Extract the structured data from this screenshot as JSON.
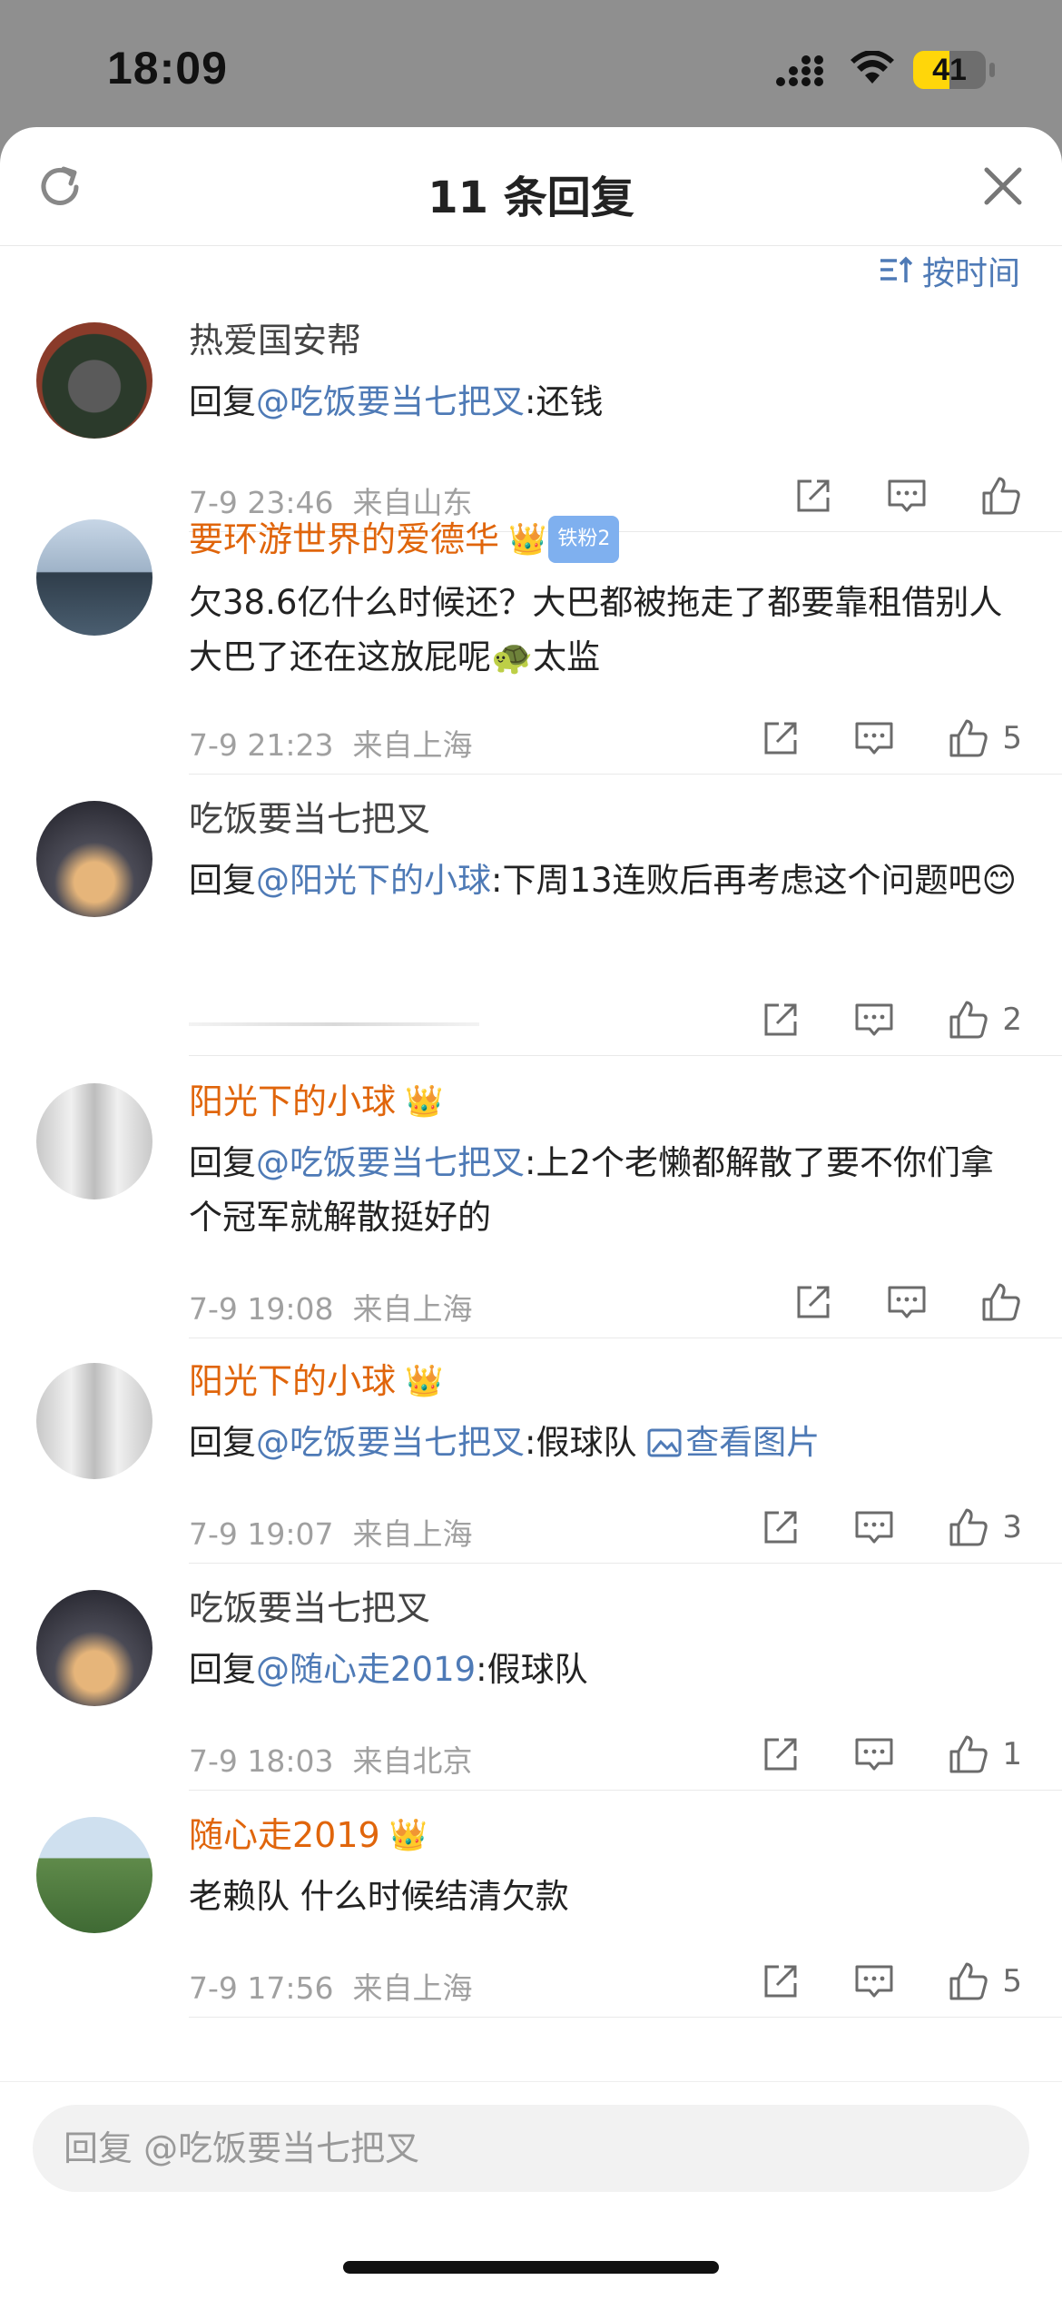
{
  "status": {
    "time": "18:09",
    "battery": "41",
    "battery_level": 0.41
  },
  "header": {
    "title": "11 条回复"
  },
  "sort": {
    "label": "按时间"
  },
  "replies": [
    {
      "user": "热爱国安帮",
      "user_style": "normal",
      "crown": "",
      "fan_badge": "",
      "prefix": "回复",
      "mention": "@吃饭要当七把叉",
      "body": ":还钱",
      "time": "7-9 23:46",
      "location": "来自山东",
      "likes": ""
    },
    {
      "user": "要环游世界的爱德华",
      "user_style": "orange",
      "crown": "👑",
      "fan_badge": "铁粉2",
      "prefix": "",
      "mention": "",
      "body": "欠38.6亿什么时候还？大巴都被拖走了都要靠租借别人大巴了还在这放屁呢🐢太监",
      "time": "7-9 21:23",
      "location": "来自上海",
      "likes": "5"
    },
    {
      "user": "吃饭要当七把叉",
      "user_style": "normal",
      "crown": "",
      "fan_badge": "",
      "prefix": "回复",
      "mention": "@阳光下的小球",
      "body": ":下周13连败后再考虑这个问题吧😊",
      "time": "",
      "location": "",
      "likes": "2"
    },
    {
      "user": "阳光下的小球",
      "user_style": "orange",
      "crown": "👑",
      "fan_badge": "",
      "prefix": "回复",
      "mention": "@吃饭要当七把叉",
      "body": ":上2个老懒都解散了要不你们拿个冠军就解散挺好的",
      "time": "7-9 19:08",
      "location": "来自上海",
      "likes": ""
    },
    {
      "user": "阳光下的小球",
      "user_style": "orange",
      "crown": "👑",
      "fan_badge": "",
      "prefix": "回复",
      "mention": "@吃饭要当七把叉",
      "body": ":假球队 ",
      "link": "查看图片",
      "time": "7-9 19:07",
      "location": "来自上海",
      "likes": "3"
    },
    {
      "user": "吃饭要当七把叉",
      "user_style": "normal",
      "crown": "",
      "fan_badge": "",
      "prefix": "回复",
      "mention": "@随心走2019",
      "body": ":假球队",
      "time": "7-9 18:03",
      "location": "来自北京",
      "likes": "1"
    },
    {
      "user": "随心走2019",
      "user_style": "orange",
      "crown": "👑",
      "fan_badge": "",
      "prefix": "",
      "mention": "",
      "body": "老赖队  什么时候结清欠款",
      "time": "7-9 17:56",
      "location": "来自上海",
      "likes": "5"
    }
  ],
  "reply_box": {
    "placeholder": "回复 @吃饭要当七把叉"
  },
  "colors": {
    "accent_blue": "#4e7ab6",
    "vip_orange": "#e0650b",
    "battery_yellow": "#ffd60a"
  }
}
